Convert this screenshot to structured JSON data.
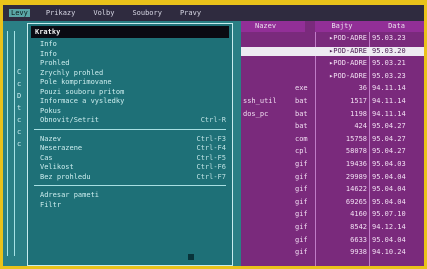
{
  "menubar": {
    "items": [
      "Levy",
      "Prikazy",
      "Volby",
      "Soubory",
      "Pravy"
    ],
    "active_index": 0
  },
  "left_side_letters": [
    "C",
    "",
    "c",
    "",
    "D",
    "",
    "t",
    "",
    "c",
    "",
    "c",
    "",
    "",
    "c"
  ],
  "dropdown": {
    "title": "Kratky",
    "items": [
      {
        "label": "Info",
        "key": ""
      },
      {
        "label": "Info",
        "key": ""
      },
      {
        "label": "Prohled",
        "key": ""
      },
      {
        "label": "Zrychly prohled",
        "key": ""
      },
      {
        "label": "Pole komprimovane",
        "key": ""
      },
      {
        "label": "Pouzi souboru pritom",
        "key": ""
      },
      {
        "label": "Informace a vysledky",
        "key": ""
      },
      {
        "label": "Pokus",
        "key": ""
      },
      {
        "label": "Obnovit/Setrit",
        "key": "Ctrl-R"
      },
      {
        "sep": true
      },
      {
        "label": "Nazev",
        "key": "Ctrl-F3"
      },
      {
        "label": "Neserazene",
        "key": "Ctrl-F4"
      },
      {
        "label": "Cas",
        "key": "Ctrl-F5"
      },
      {
        "label": "Velikost",
        "key": "Ctrl-F6"
      },
      {
        "label": "Bez prohledu",
        "key": "Ctrl-F7"
      },
      {
        "sep": true
      },
      {
        "label": "Adresar pameti",
        "key": ""
      },
      {
        "label": "Filtr",
        "key": ""
      }
    ]
  },
  "filepanel": {
    "headers": [
      "Nazev",
      "Bajty",
      "Data"
    ],
    "rows": [
      {
        "name": "",
        "ext": "",
        "size": "▸POD-ADRE",
        "date": "95.03.23"
      },
      {
        "name": "",
        "ext": "",
        "size": "▸POD-ADRE",
        "date": "95.03.20",
        "highlight": true
      },
      {
        "name": "",
        "ext": "",
        "size": "▸POD-ADRE",
        "date": "95.03.21"
      },
      {
        "name": "",
        "ext": "",
        "size": "▸POD-ADRE",
        "date": "95.03.23"
      },
      {
        "name": "",
        "ext": "exe",
        "size": "36",
        "date": "94.11.14"
      },
      {
        "name": "ssh_util",
        "ext": "bat",
        "size": "1517",
        "date": "94.11.14"
      },
      {
        "name": "dos_pc",
        "ext": "bat",
        "size": "1198",
        "date": "94.11.14"
      },
      {
        "name": "",
        "ext": "bat",
        "size": "424",
        "date": "95.04.27"
      },
      {
        "name": "",
        "ext": "com",
        "size": "15758",
        "date": "95.04.27"
      },
      {
        "name": "",
        "ext": "cpl",
        "size": "58078",
        "date": "95.04.27"
      },
      {
        "name": "",
        "ext": "gif",
        "size": "19436",
        "date": "95.04.03"
      },
      {
        "name": "",
        "ext": "gif",
        "size": "29989",
        "date": "95.04.04"
      },
      {
        "name": "",
        "ext": "gif",
        "size": "14622",
        "date": "95.04.04"
      },
      {
        "name": "",
        "ext": "gif",
        "size": "69265",
        "date": "95.04.04"
      },
      {
        "name": "",
        "ext": "gif",
        "size": "4160",
        "date": "95.07.10"
      },
      {
        "name": "",
        "ext": "gif",
        "size": "8542",
        "date": "94.12.14"
      },
      {
        "name": "",
        "ext": "gif",
        "size": "6633",
        "date": "95.04.04"
      },
      {
        "name": "",
        "ext": "gif",
        "size": "9938",
        "date": "94.10.24"
      }
    ]
  },
  "colors": {
    "monitor_frame": "#e9c21a",
    "left_panel": "#2a7f85",
    "right_panel": "#7a2a7c",
    "highlight_row": "#eeeaf2"
  }
}
